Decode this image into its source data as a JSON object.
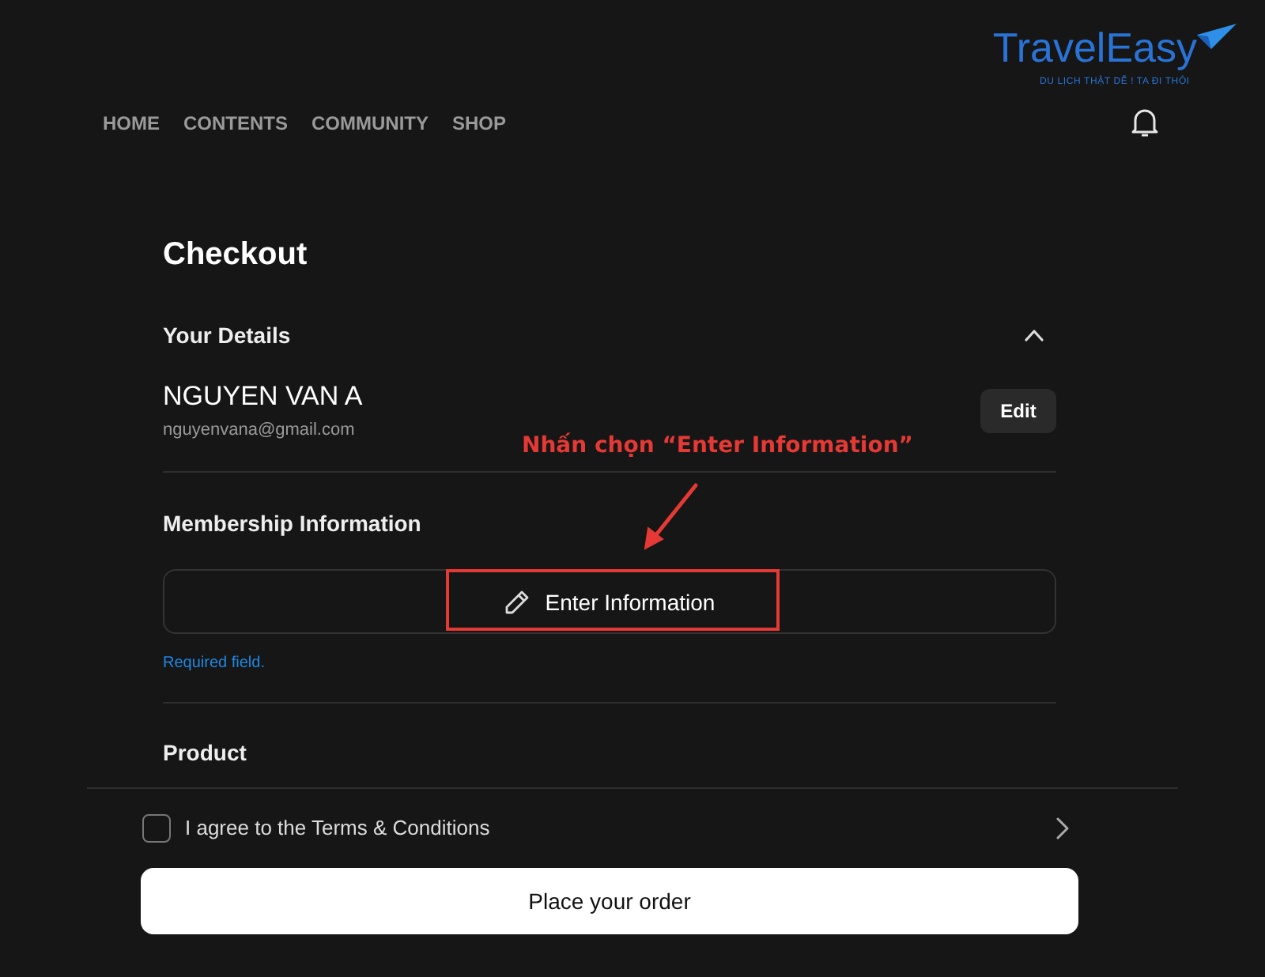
{
  "logo": {
    "wordmark": "TravelEasy",
    "tagline": "DU LỊCH THẬT DỄ ! TA ĐI THÔI"
  },
  "nav": {
    "items": [
      {
        "label": "HOME"
      },
      {
        "label": "CONTENTS"
      },
      {
        "label": "COMMUNITY"
      },
      {
        "label": "SHOP"
      }
    ]
  },
  "page_title": "Checkout",
  "your_details": {
    "heading": "Your Details",
    "expanded": true,
    "name": "NGUYEN VAN A",
    "email": "nguyenvana@gmail.com",
    "edit_button": "Edit"
  },
  "membership": {
    "heading": "Membership Information",
    "button": "Enter Information",
    "hint": "Required field."
  },
  "product": {
    "heading": "Product"
  },
  "footer": {
    "terms": {
      "label": "I agree to the Terms & Conditions",
      "checked": false
    },
    "order_button": "Place your order"
  },
  "annotation": {
    "text": "Nhấn chọn “Enter Information”"
  }
}
